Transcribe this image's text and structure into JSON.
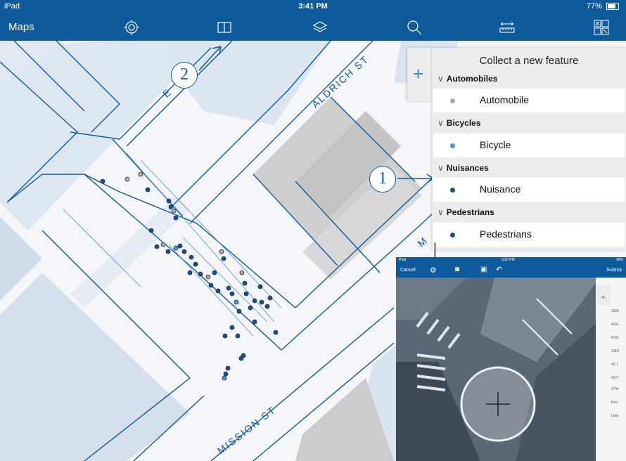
{
  "status_bar": {
    "device": "iPad",
    "time": "3:41 PM",
    "battery": "77%"
  },
  "toolbar": {
    "title": "Maps",
    "icons": [
      "locate-icon",
      "bookmarks-icon",
      "layers-icon",
      "search-icon",
      "measure-icon",
      "collect-icon"
    ]
  },
  "streets": {
    "aldrich": "ALDRICH ST",
    "mission": "MISSION ST",
    "partial_left": "E",
    "partial_right": "M"
  },
  "callouts": {
    "one": "1",
    "two": "2"
  },
  "collect_panel": {
    "title": "Collect a new feature",
    "groups": [
      {
        "name": "Automobiles",
        "item": "Automobile",
        "dot_color": "#a9a9a9"
      },
      {
        "name": "Bicycles",
        "item": "Bicycle",
        "dot_color": "#4f8fdc"
      },
      {
        "name": "Nuisances",
        "item": "Nuisance",
        "dot_color": "#1d4e8f"
      },
      {
        "name": "Pedestrians",
        "item": "Pedestrians",
        "dot_color": "#1d4e8f"
      }
    ]
  },
  "inset": {
    "status_left": "iPad",
    "status_time": "3:02 PM",
    "status_right": "98%",
    "cancel": "Cancel",
    "submit": "Submit",
    "form_labels": [
      "GEN",
      "AGE",
      "POS",
      "GRO",
      "ACT",
      "ACT",
      "OTH",
      "Hou",
      "Date"
    ]
  }
}
